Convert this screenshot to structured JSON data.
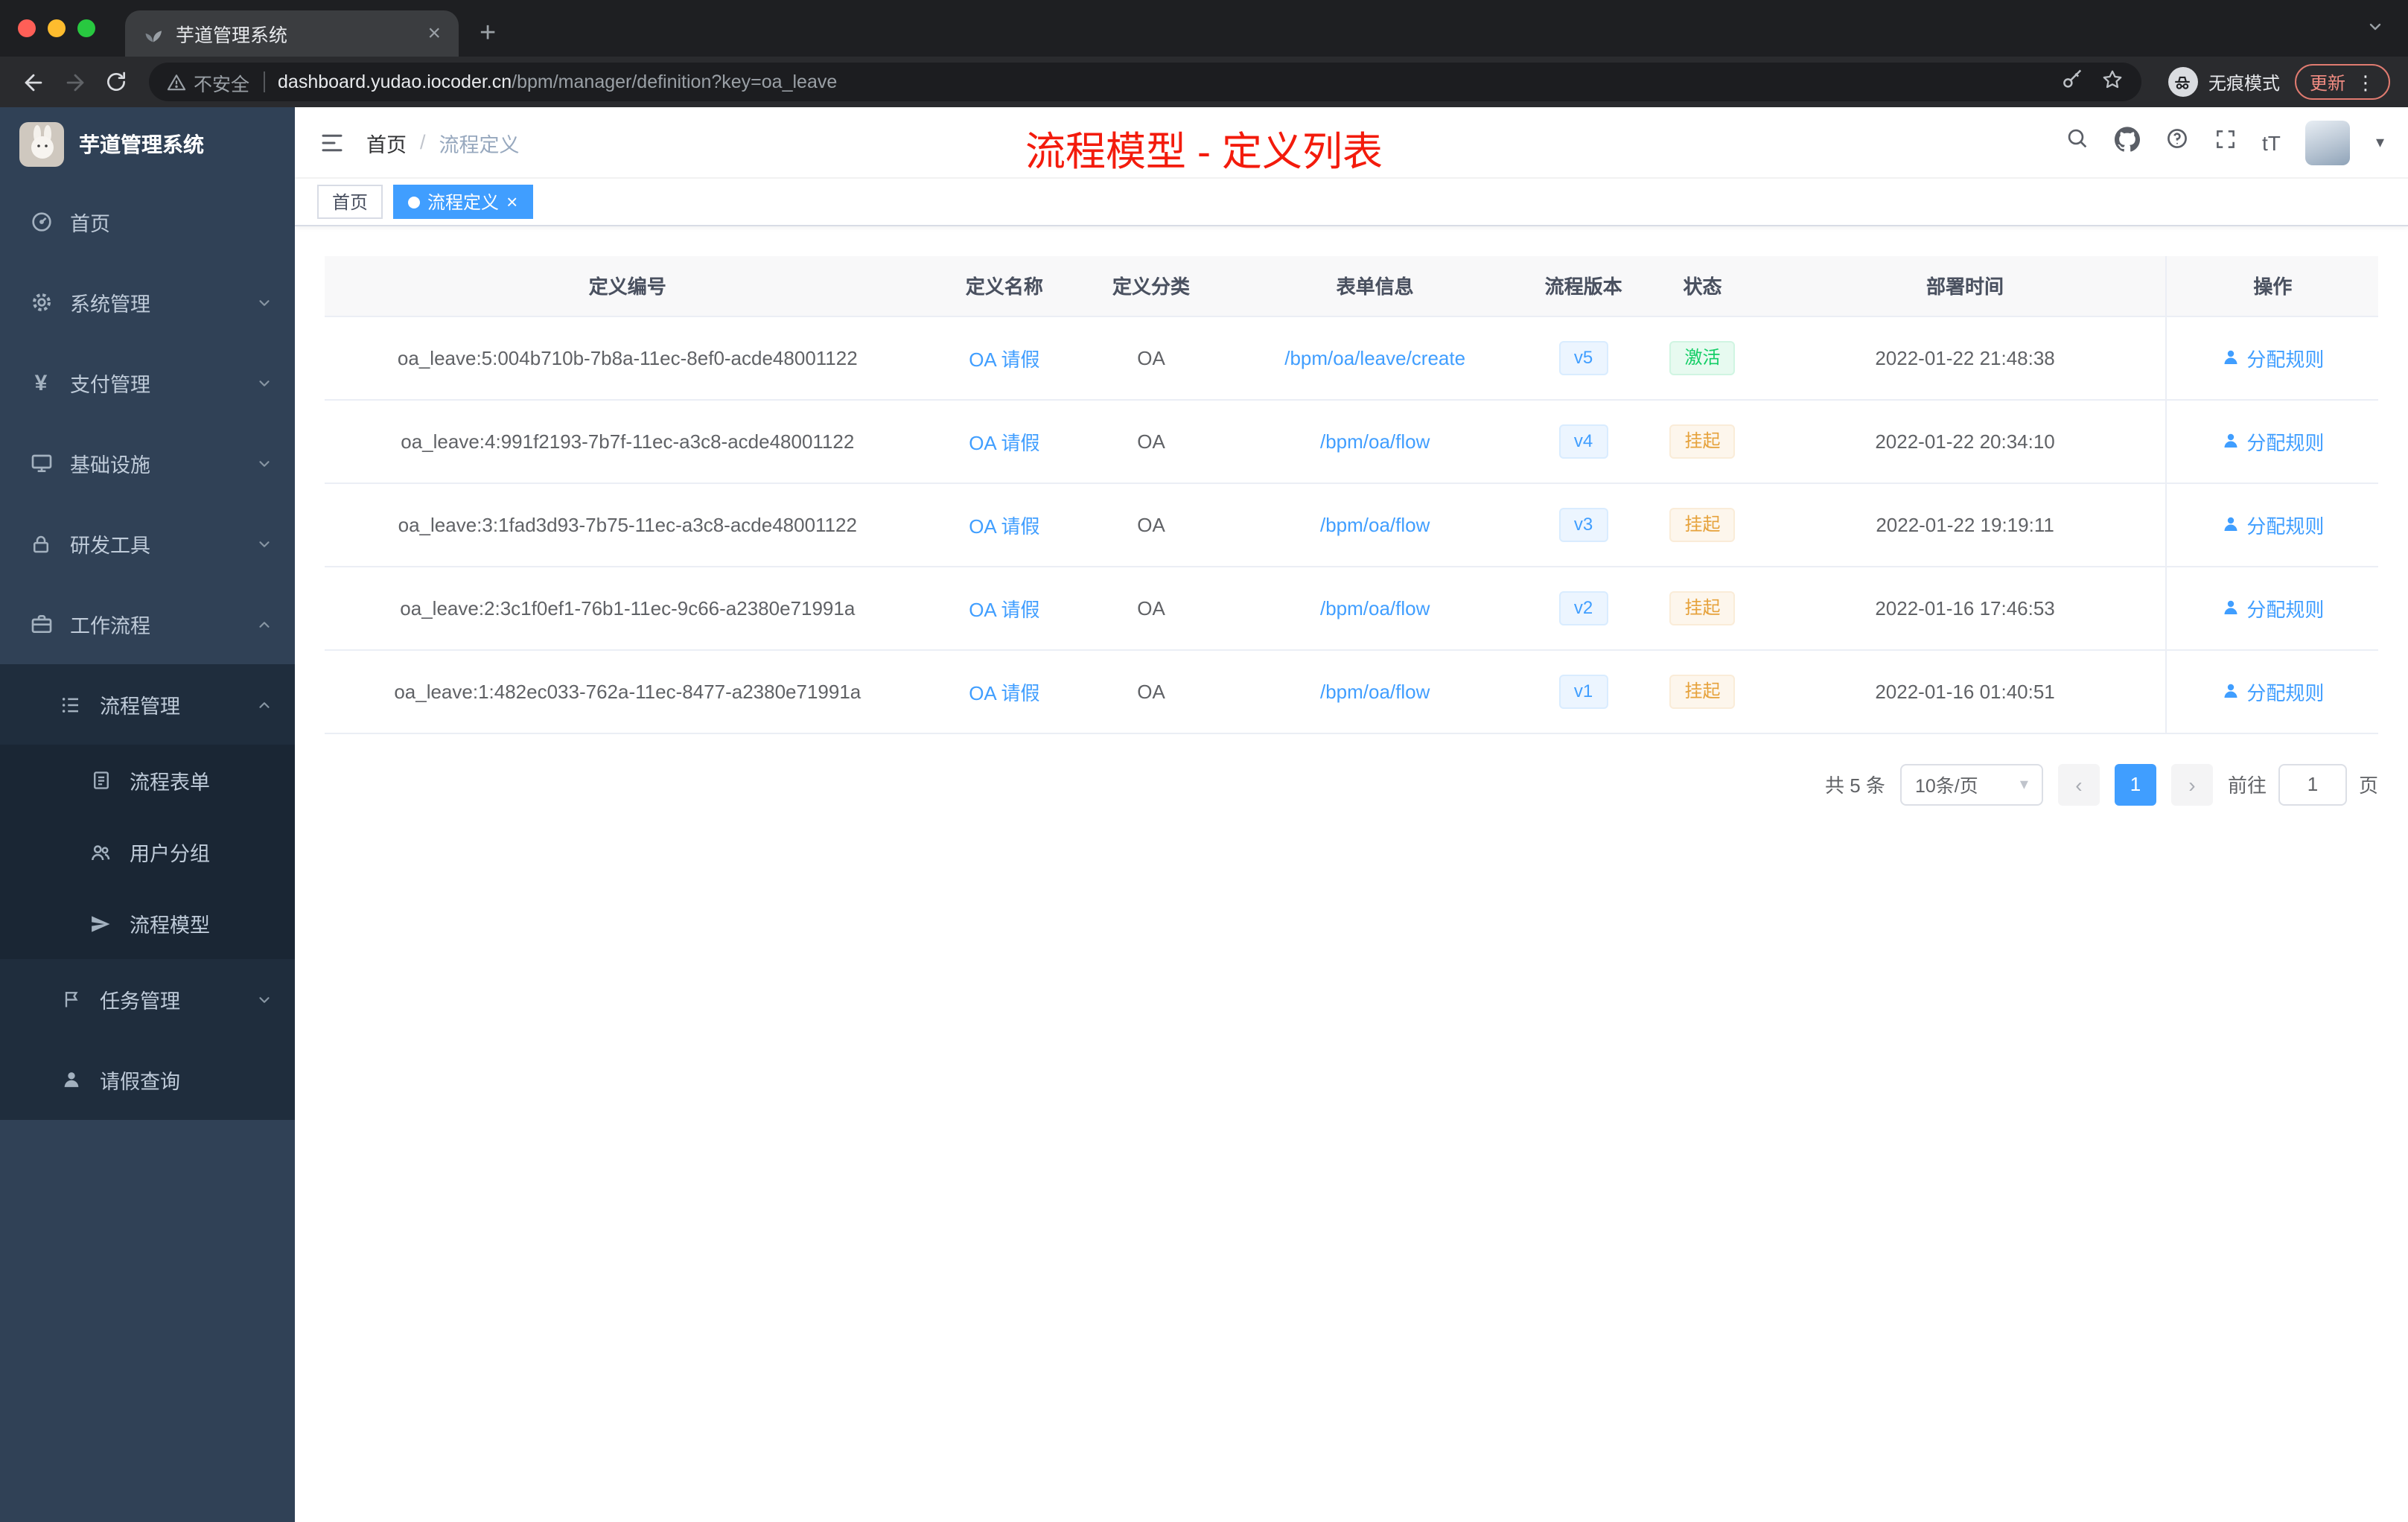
{
  "browser": {
    "tab_title": "芋道管理系统",
    "security_label": "不安全",
    "url_host": "dashboard.yudao.iocoder.cn",
    "url_path": "/bpm/manager/definition?key=oa_leave",
    "incognito_label": "无痕模式",
    "update_label": "更新"
  },
  "glyphs": {
    "close": "×",
    "plus": "+",
    "kebab": "⋮",
    "caret_down": "▾",
    "font_size": "tT",
    "yen": "¥",
    "prev": "‹",
    "next": "›"
  },
  "sidebar": {
    "logo_title": "芋道管理系统",
    "items": [
      {
        "label": "首页"
      },
      {
        "label": "系统管理"
      },
      {
        "label": "支付管理"
      },
      {
        "label": "基础设施"
      },
      {
        "label": "研发工具"
      },
      {
        "label": "工作流程"
      },
      {
        "label": "流程管理"
      },
      {
        "label": "流程表单"
      },
      {
        "label": "用户分组"
      },
      {
        "label": "流程模型"
      },
      {
        "label": "任务管理"
      },
      {
        "label": "请假查询"
      }
    ]
  },
  "header": {
    "breadcrumb_home": "首页",
    "breadcrumb_sep": "/",
    "breadcrumb_current": "流程定义",
    "annotation": "流程模型 - 定义列表"
  },
  "tags": {
    "home": "首页",
    "current": "流程定义"
  },
  "table": {
    "columns": [
      "定义编号",
      "定义名称",
      "定义分类",
      "表单信息",
      "流程版本",
      "状态",
      "部署时间",
      "操作"
    ],
    "rows": [
      {
        "id": "oa_leave:5:004b710b-7b8a-11ec-8ef0-acde48001122",
        "name": "OA 请假",
        "category": "OA",
        "form": "/bpm/oa/leave/create",
        "version": "v5",
        "status": "激活",
        "time": "2022-01-22 21:48:38",
        "action": "分配规则"
      },
      {
        "id": "oa_leave:4:991f2193-7b7f-11ec-a3c8-acde48001122",
        "name": "OA 请假",
        "category": "OA",
        "form": "/bpm/oa/flow",
        "version": "v4",
        "status": "挂起",
        "time": "2022-01-22 20:34:10",
        "action": "分配规则"
      },
      {
        "id": "oa_leave:3:1fad3d93-7b75-11ec-a3c8-acde48001122",
        "name": "OA 请假",
        "category": "OA",
        "form": "/bpm/oa/flow",
        "version": "v3",
        "status": "挂起",
        "time": "2022-01-22 19:19:11",
        "action": "分配规则"
      },
      {
        "id": "oa_leave:2:3c1f0ef1-76b1-11ec-9c66-a2380e71991a",
        "name": "OA 请假",
        "category": "OA",
        "form": "/bpm/oa/flow",
        "version": "v2",
        "status": "挂起",
        "time": "2022-01-16 17:46:53",
        "action": "分配规则"
      },
      {
        "id": "oa_leave:1:482ec033-762a-11ec-8477-a2380e71991a",
        "name": "OA 请假",
        "category": "OA",
        "form": "/bpm/oa/flow",
        "version": "v1",
        "status": "挂起",
        "time": "2022-01-16 01:40:51",
        "action": "分配规则"
      }
    ]
  },
  "pagination": {
    "total": "共 5 条",
    "page_size": "10条/页",
    "current_page": "1",
    "goto_label": "前往",
    "goto_value": "1",
    "goto_unit": "页"
  },
  "colors": {
    "accent_blue": "#409eff",
    "annotation_red": "#f31b0c",
    "status_active_green": "#13ce66",
    "status_suspended_orange": "#e6a23c",
    "sidebar_bg": "#304156",
    "submenu_bg": "#1f2d3d"
  }
}
